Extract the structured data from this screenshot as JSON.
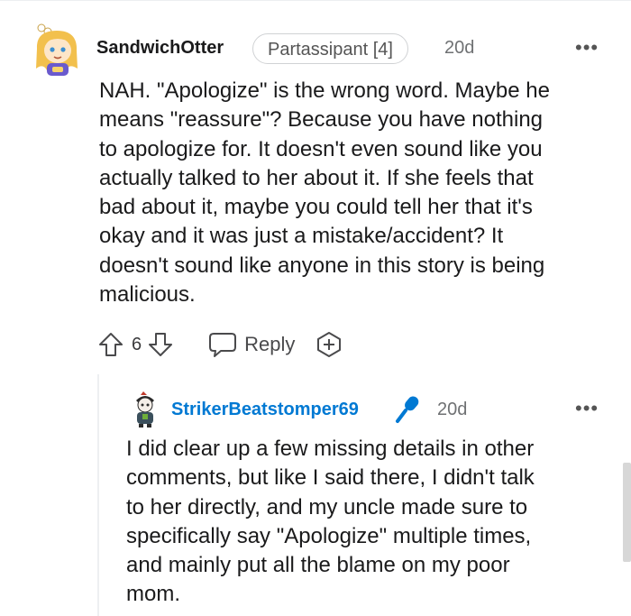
{
  "comment": {
    "username": "SandwichOtter",
    "flair": "Partassipant [4]",
    "age": "20d",
    "more": "•••",
    "body_lines": [
      "NAH. \"Apologize\" is the wrong word. Maybe he",
      "means \"reassure\"? Because you have nothing",
      "to apologize for. It doesn't even sound like you",
      "actually talked to her about it. If she feels that",
      "bad about it, maybe you could tell her that it's",
      "okay and it was just a mistake/accident? It",
      "doesn't sound like anyone in this story is being",
      "malicious."
    ],
    "vote_count": "6",
    "reply_label": "Reply",
    "icons": {
      "upvote": "arrow-up-icon",
      "downvote": "arrow-down-icon",
      "reply": "speech-bubble-icon",
      "award": "award-plus-icon"
    }
  },
  "reply": {
    "username": "StrikerBeatstomper69",
    "age": "20d",
    "more": "•••",
    "badge_icon": "microphone-icon",
    "badge_color": "#0079d3",
    "body_lines": [
      "I did clear up a few missing details in other",
      "comments, but like I said there, I didn't talk",
      "to her directly, and my uncle made sure to",
      "specifically say \"Apologize\" multiple times,",
      "and mainly put all the blame on my poor",
      "mom."
    ]
  }
}
